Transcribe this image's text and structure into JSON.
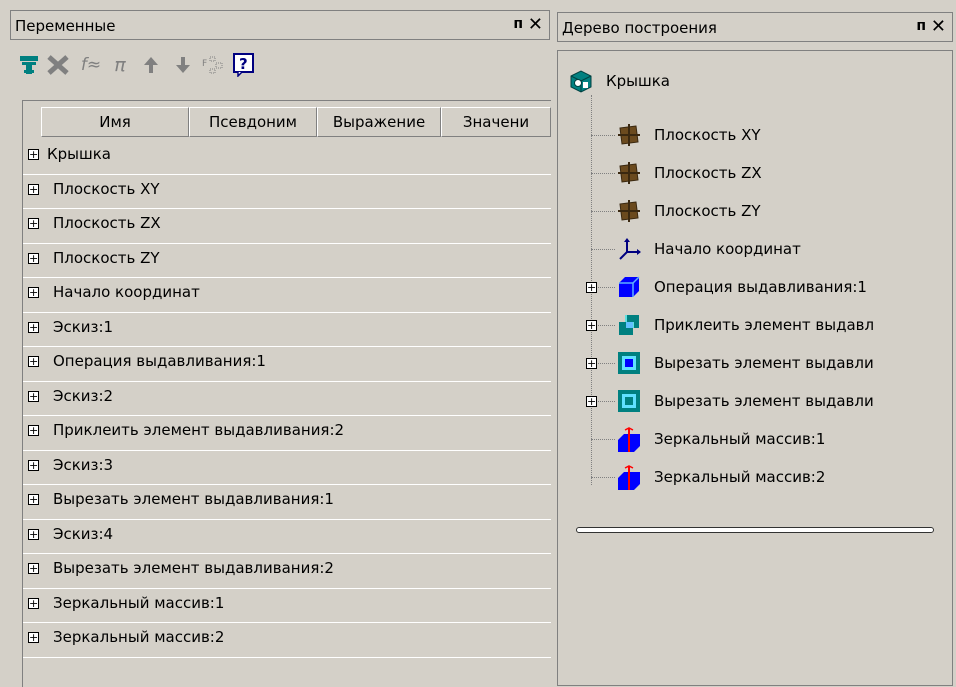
{
  "variables_panel": {
    "title": "Переменные",
    "pin_glyph": "ф",
    "close_glyph": "✕",
    "toolbar": {
      "icons": [
        "variables-table-icon",
        "delete-icon",
        "function-icon",
        "pi-icon",
        "move-up-icon",
        "move-down-icon",
        "expand-icon",
        "help-icon"
      ],
      "fx_label": "f≈",
      "pi_label": "π",
      "help_label": "?"
    },
    "columns": [
      "Имя",
      "Псевдоним",
      "Выражение",
      "Значени"
    ],
    "rows": [
      "Крышка",
      "Плоскость XY",
      "Плоскость ZX",
      "Плоскость ZY",
      "Начало координат",
      "Эскиз:1",
      "Операция выдавливания:1",
      "Эскиз:2",
      "Приклеить элемент выдавливания:2",
      "Эскиз:3",
      "Вырезать элемент выдавливания:1",
      "Эскиз:4",
      "Вырезать элемент выдавливания:2",
      "Зеркальный массив:1",
      "Зеркальный массив:2"
    ]
  },
  "tree_panel": {
    "title": "Дерево построения",
    "pin_glyph": "ф",
    "close_glyph": "✕",
    "root": "Крышка",
    "items": [
      {
        "label": "Плоскость XY",
        "icon": "plane-icon",
        "expandable": false
      },
      {
        "label": "Плоскость ZX",
        "icon": "plane-icon",
        "expandable": false
      },
      {
        "label": "Плоскость ZY",
        "icon": "plane-icon",
        "expandable": false
      },
      {
        "label": "Начало координат",
        "icon": "origin-axes-icon",
        "expandable": false
      },
      {
        "label": "Операция выдавливания:1",
        "icon": "extrude-icon",
        "expandable": true
      },
      {
        "label": "Приклеить элемент выдавл",
        "icon": "boss-extrude-icon",
        "expandable": true
      },
      {
        "label": "Вырезать элемент выдавли",
        "icon": "cut-extrude-icon",
        "expandable": true
      },
      {
        "label": "Вырезать элемент выдавли",
        "icon": "cut-extrude-icon",
        "expandable": true
      },
      {
        "label": "Зеркальный массив:1",
        "icon": "mirror-array-icon",
        "expandable": false
      },
      {
        "label": "Зеркальный массив:2",
        "icon": "mirror-array-icon",
        "expandable": false
      }
    ],
    "expander_glyph": "+"
  },
  "colors": {
    "background": "#d4d0c8",
    "teal_icon": "#008080",
    "blue_icon": "#0000ff",
    "plane_brown": "#6b4a1e"
  }
}
